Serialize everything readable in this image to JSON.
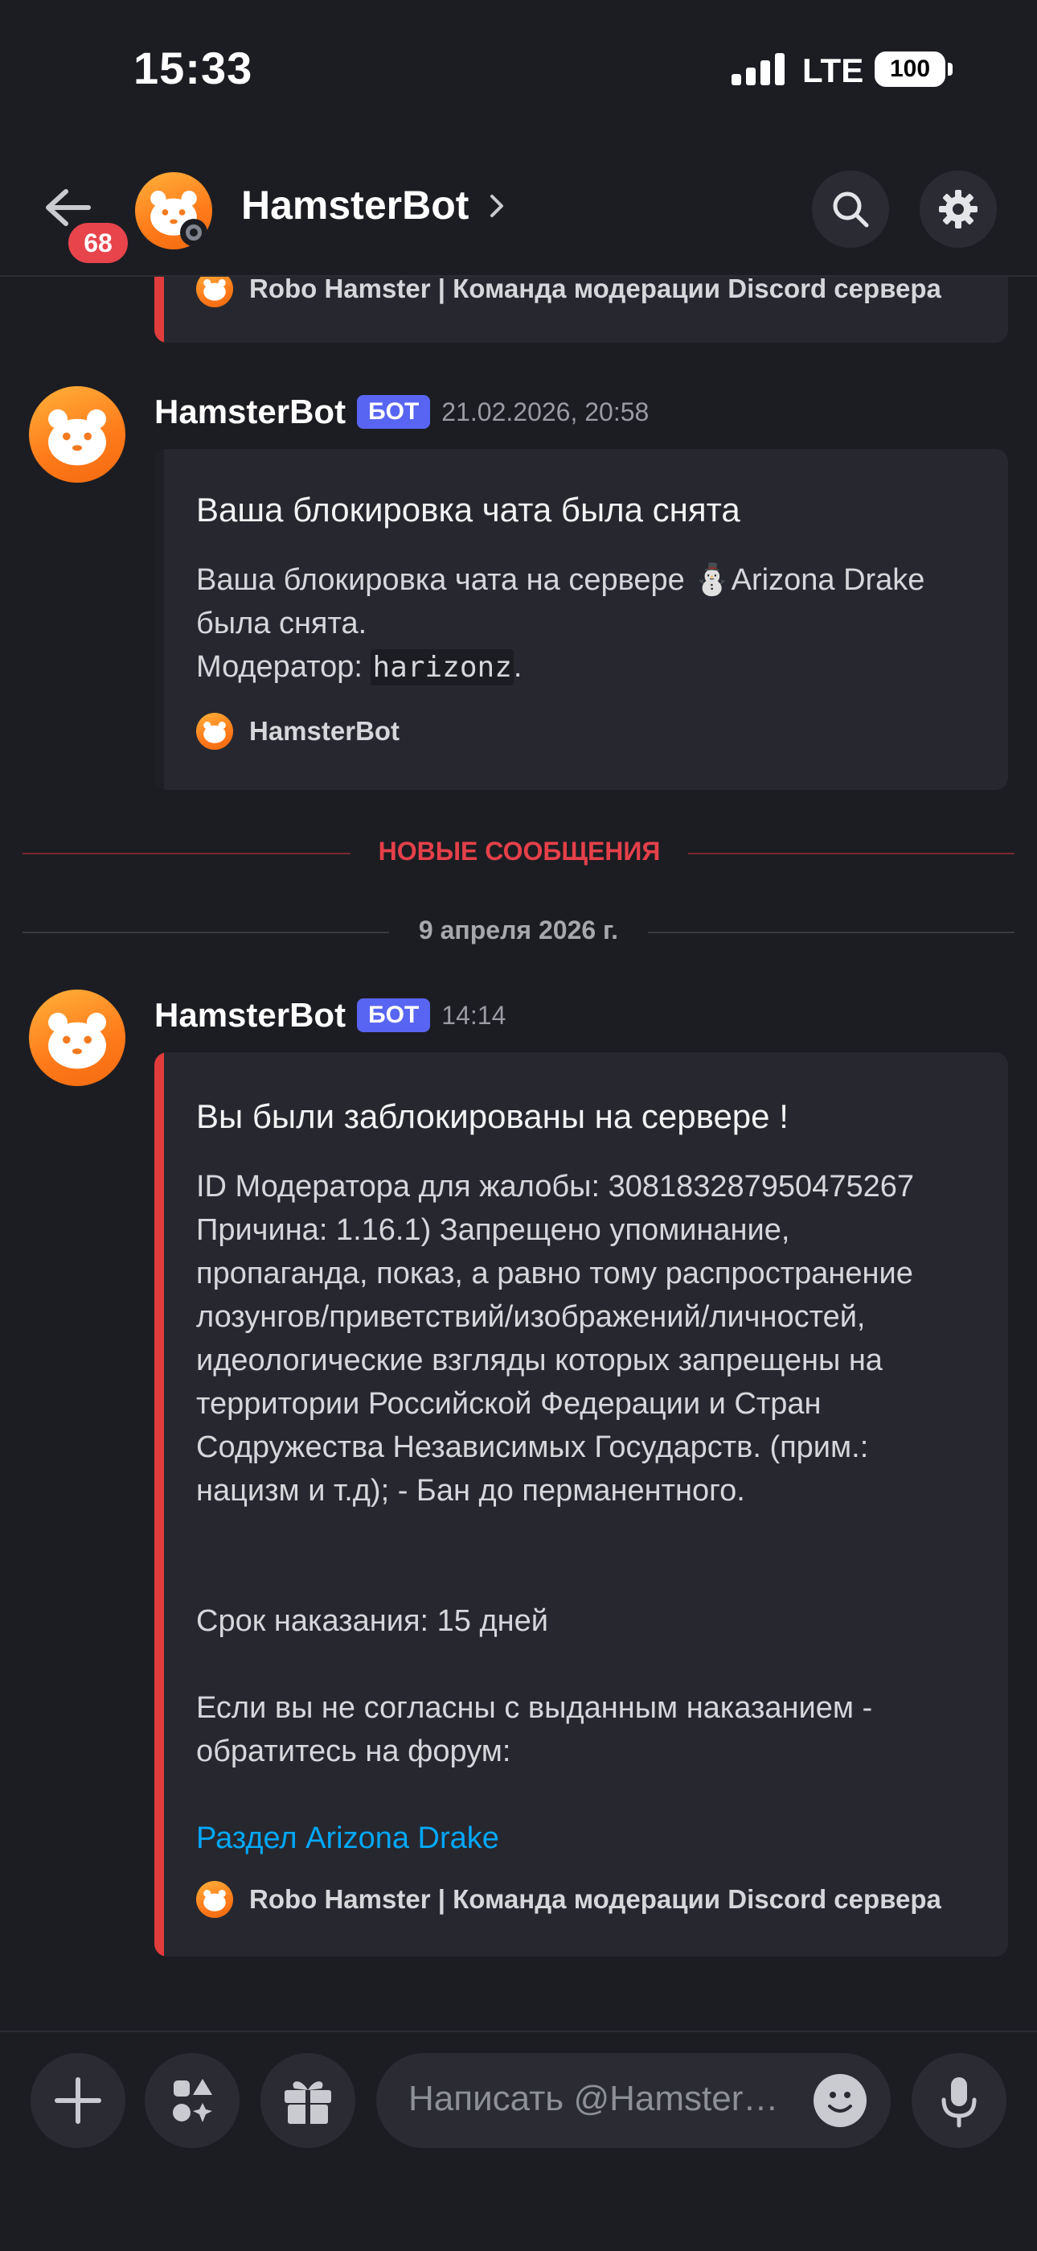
{
  "status_bar": {
    "time": "15:33",
    "network": "LTE",
    "battery": "100"
  },
  "header": {
    "title": "HamsterBot",
    "unread_badge": "68"
  },
  "top_embed": {
    "footer": "Robo Hamster | Команда модерации Discord сервера",
    "accent": "#e03c3c"
  },
  "message_1": {
    "author": "HamsterBot",
    "tag": "БОТ",
    "timestamp": "21.02.2026, 20:58",
    "embed": {
      "title": "Ваша блокировка чата была снята",
      "line1_prefix": "Ваша блокировка чата на сервере ",
      "server_emoji": "⛄",
      "line1_suffix": "Arizona Drake",
      "line2": "была снята.",
      "moderator_label": "Модератор: ",
      "moderator_value": "harizonz",
      "moderator_suffix": ".",
      "footer": "HamsterBot",
      "accent": "#1f2025"
    }
  },
  "new_messages_divider": {
    "label": "НОВЫЕ СООБЩЕНИЯ",
    "color": "#e5404a"
  },
  "date_divider": {
    "label": "9 апреля 2026 г."
  },
  "message_2": {
    "author": "HamsterBot",
    "tag": "БОТ",
    "timestamp": "14:14",
    "embed": {
      "title": "Вы были заблокированы на сервере !",
      "lines": [
        "ID Модератора для жалобы: 308183287950475267",
        "Причина: 1.16.1) Запрещено упоминание,",
        "пропаганда, показ, а равно тому распространение",
        "лозунгов/приветствий/изображений/личностей,",
        "идеологические взгляды которых запрещены на",
        "территории Российской Федерации и Стран",
        "Содружества Независимых Государств. (прим.:",
        "нацизм и т.д); - Бан до перманентного."
      ],
      "term": "Срок наказания: 15 дней",
      "appeal_line1": "Если вы не согласны с выданным наказанием -",
      "appeal_line2": "обратитесь на форум:",
      "link": "Раздел Arizona Drake",
      "footer": "Robo Hamster | Команда модерации Discord сервера",
      "accent": "#e03c3c"
    }
  },
  "composer": {
    "placeholder": "Написать @HamsterBot"
  },
  "colors": {
    "background": "#1c1d22",
    "bot_tag": "#5865f2",
    "link": "#00a8fc",
    "badge": "#e7444c"
  }
}
